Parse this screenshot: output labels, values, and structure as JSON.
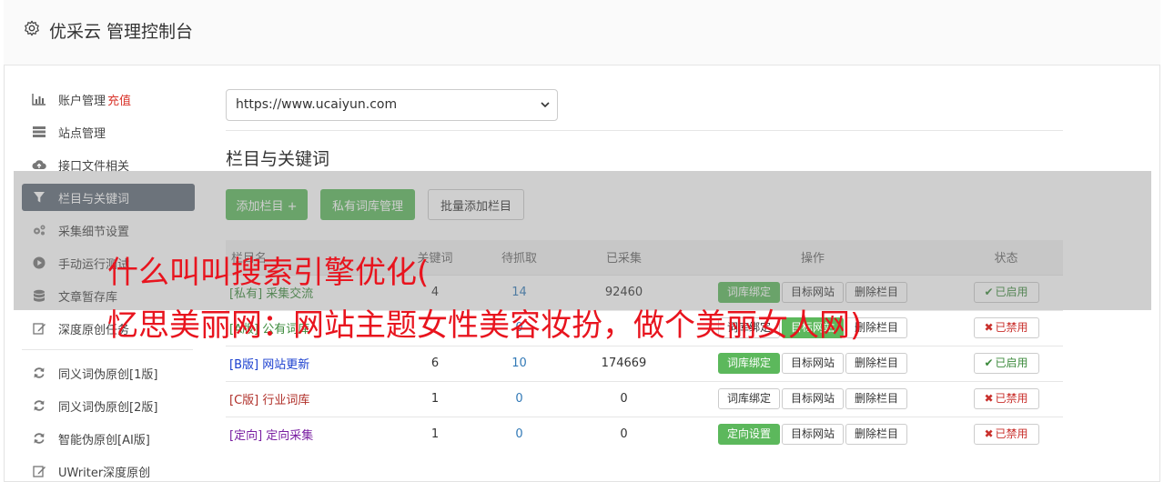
{
  "header": {
    "title": "优采云 管理控制台",
    "icon": "gear-icon"
  },
  "sidebar": {
    "items": [
      {
        "label": "账户管理",
        "extra": "充值",
        "icon": "bar-chart-icon"
      },
      {
        "label": "站点管理",
        "icon": "server-icon"
      },
      {
        "label": "接口文件相关",
        "icon": "cloud-upload-icon"
      },
      {
        "label": "栏目与关键词",
        "icon": "filter-icon"
      },
      {
        "label": "采集细节设置",
        "icon": "gears-icon"
      },
      {
        "label": "手动运行测试",
        "icon": "play-circle-icon"
      },
      {
        "label": "文章暂存库",
        "icon": "database-icon"
      },
      {
        "label": "深度原创任务",
        "icon": "edit-icon"
      },
      {
        "label": "同义词伪原创[1版]",
        "icon": "refresh-icon"
      },
      {
        "label": "同义词伪原创[2版]",
        "icon": "refresh-icon"
      },
      {
        "label": "智能伪原创[AI版]",
        "icon": "refresh-icon"
      },
      {
        "label": "UWriter深度原创",
        "icon": "edit-icon"
      }
    ]
  },
  "main": {
    "site_select": "https://www.ucaiyun.com",
    "section_title": "栏目与关键词",
    "buttons": {
      "add_column": "添加栏目 +",
      "private_lib": "私有词库管理",
      "batch_add": "批量添加栏目"
    },
    "table": {
      "headers": [
        "栏目名",
        "关键词",
        "待抓取",
        "已采集",
        "操作",
        "状态"
      ],
      "rows": [
        {
          "tag": "[私有]",
          "name": "采集交流",
          "color": "#3c8a3c",
          "kw": "4",
          "pending": "14",
          "collected": "92460",
          "op1": "词库绑定",
          "op1_green": true,
          "op2": "目标网站",
          "op3": "删除栏目",
          "status": "已启用",
          "on": true
        },
        {
          "tag": "[A版]",
          "name": "公有词库",
          "color": "#3c8a3c",
          "kw": "",
          "pending": "0",
          "collected": "",
          "op1": "词库绑定",
          "op1_green": false,
          "op2": "目标网站",
          "op2_green": true,
          "op3": "删除栏目",
          "status": "已禁用",
          "on": false
        },
        {
          "tag": "[B版]",
          "name": "网站更新",
          "color": "#1a3fcf",
          "kw": "6",
          "pending": "10",
          "collected": "174669",
          "op1": "词库绑定",
          "op1_green": true,
          "op2": "目标网站",
          "op3": "删除栏目",
          "status": "已启用",
          "on": true
        },
        {
          "tag": "[C版]",
          "name": "行业词库",
          "color": "#b0302a",
          "kw": "1",
          "pending": "0",
          "collected": "0",
          "op1": "词库绑定",
          "op1_green": false,
          "op2": "目标网站",
          "op3": "删除栏目",
          "status": "已禁用",
          "on": false
        },
        {
          "tag": "[定向]",
          "name": "定向采集",
          "color": "#7a1fa2",
          "kw": "1",
          "pending": "0",
          "collected": "0",
          "op1": "定向设置",
          "op1_green": true,
          "op2": "目标网站",
          "op3": "删除栏目",
          "status": "已禁用",
          "on": false
        }
      ]
    }
  },
  "overlay": {
    "line1": "什么叫叫搜索引擎优化(",
    "line2": "忆思美丽网：网站主题女性美容妆扮，做个美丽女人网)"
  }
}
